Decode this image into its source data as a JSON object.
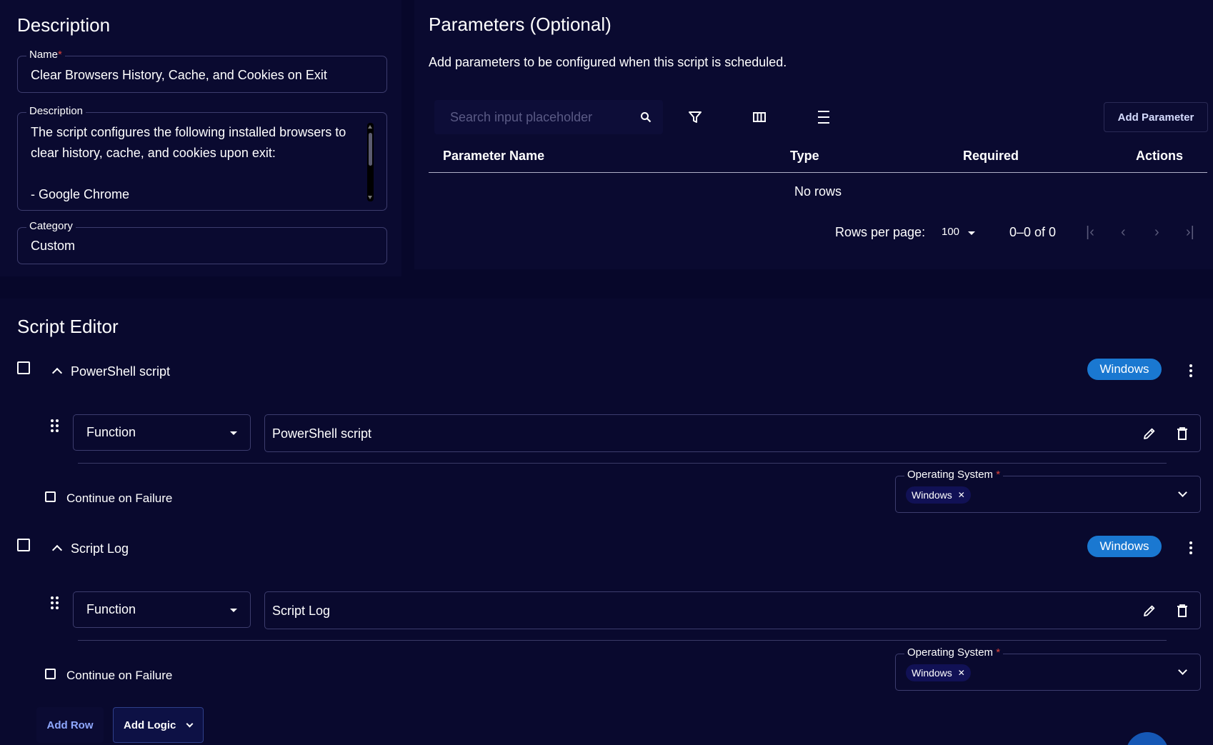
{
  "description_section": {
    "title": "Description",
    "name_label": "Name",
    "name_value": "Clear Browsers History, Cache, and Cookies on Exit",
    "description_label": "Description",
    "description_value": "The script configures the following installed browsers to clear history, cache, and cookies upon exit:\n\n- Google Chrome",
    "category_label": "Category",
    "category_value": "Custom"
  },
  "parameters_section": {
    "title": "Parameters (Optional)",
    "subtitle": "Add parameters to be configured when this script is scheduled.",
    "search_placeholder": "Search input placeholder",
    "add_parameter_label": "Add Parameter",
    "columns": [
      "Parameter Name",
      "Type",
      "Required",
      "Actions"
    ],
    "empty_text": "No rows",
    "pagination": {
      "rows_per_page_label": "Rows per page:",
      "rows_per_page_value": "100",
      "range_text": "0–0 of 0"
    }
  },
  "script_editor": {
    "title": "Script Editor",
    "rows": [
      {
        "title": "PowerShell script",
        "os_badge": "Windows",
        "type_value": "Function",
        "function_value": "PowerShell script",
        "continue_label": "Continue on Failure",
        "os_field_label": "Operating System",
        "os_tags": [
          "Windows"
        ]
      },
      {
        "title": "Script Log",
        "os_badge": "Windows",
        "type_value": "Function",
        "function_value": "Script Log",
        "continue_label": "Continue on Failure",
        "os_field_label": "Operating System",
        "os_tags": [
          "Windows"
        ]
      }
    ],
    "add_row_label": "Add Row",
    "add_logic_label": "Add Logic"
  },
  "colors": {
    "background": "#07072a",
    "panel": "#0a0a30",
    "accent_badge": "#1a78d1",
    "required_star": "#e0433a"
  }
}
